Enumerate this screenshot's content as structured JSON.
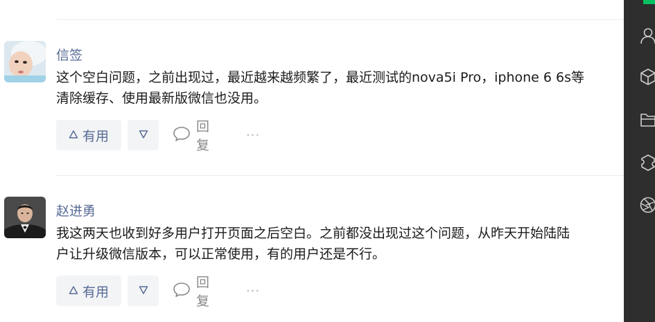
{
  "comments": [
    {
      "author": "信签",
      "avatar": "baby-photo",
      "lines": [
        "这个空白问题，之前出现过，最近越来越频繁了，最近测试的nova5i Pro，iphone 6 6s等",
        "清除缓存、使用最新版微信也没用。"
      ],
      "useful_label": "有用",
      "reply_label": "回复",
      "more_label": "···"
    },
    {
      "author": "赵进勇",
      "avatar": "man-in-suit-photo",
      "lines": [
        "我这两天也收到好多用户打开页面之后空白。之前都没出现过这个问题，从昨天开始陆陆",
        "户让升级微信版本，可以正常使用，有的用户还是不行。"
      ],
      "useful_label": "有用",
      "reply_label": "回复",
      "more_label": "···"
    }
  ],
  "sidebar_icons": [
    "user-icon",
    "cube-icon",
    "folder-icon",
    "puzzle-icon",
    "aperture-icon"
  ],
  "colors": {
    "link": "#576b95",
    "button_bg": "#f3f4f6",
    "sidebar_bg": "#2e2e2e",
    "accent_green": "#07c160"
  }
}
